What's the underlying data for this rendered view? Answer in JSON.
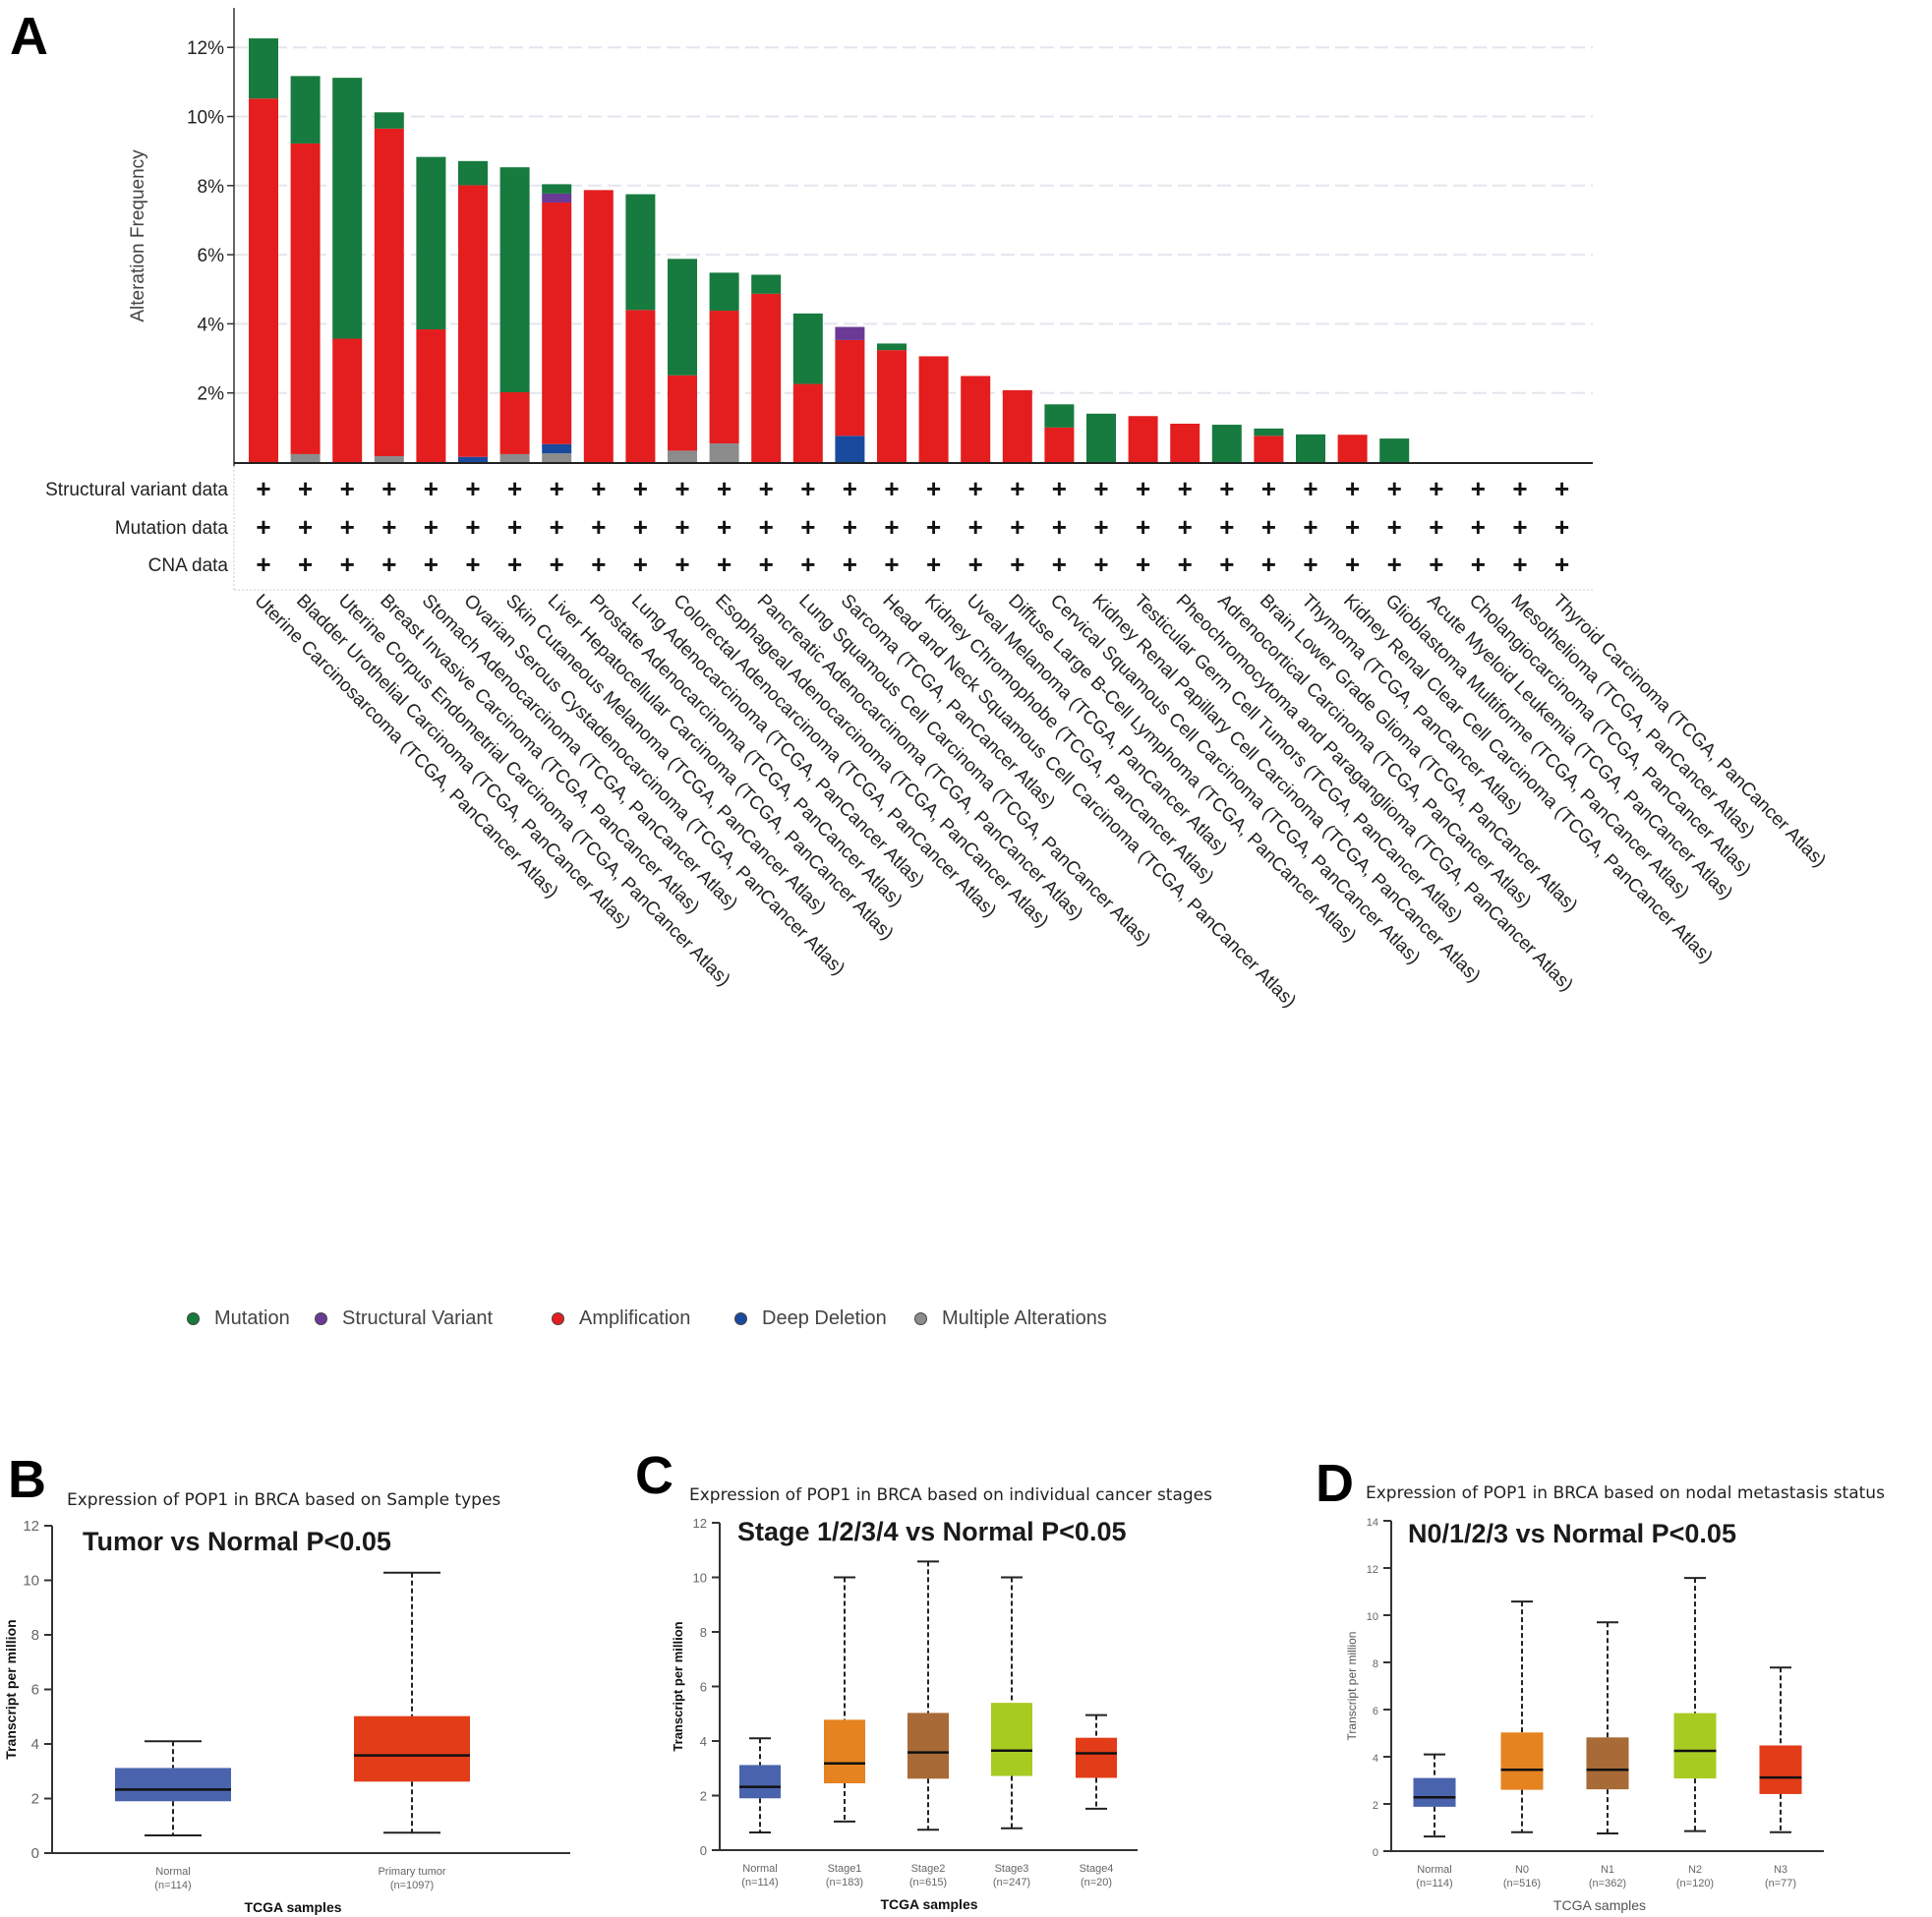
{
  "figure": {
    "panel_labels": [
      "A",
      "B",
      "C",
      "D"
    ]
  },
  "chart_data": [
    {
      "id": "A",
      "type": "bar",
      "stacked": true,
      "title": "",
      "xlabel": "",
      "ylabel": "Alteration Frequency",
      "ylim": [
        0,
        13
      ],
      "yticks": [
        2,
        4,
        6,
        8,
        10,
        12
      ],
      "ytick_labels": [
        "2%",
        "4%",
        "6%",
        "8%",
        "10%",
        "12%"
      ],
      "grid": true,
      "legend_position": "bottom",
      "categories": [
        "Uterine Carcinosarcoma (TCGA, PanCancer Atlas)",
        "Bladder Urothelial Carcinoma (TCGA, PanCancer Atlas)",
        "Uterine Corpus Endometrial Carcinoma (TCGA, PanCancer Atlas)",
        "Breast Invasive Carcinoma (TCGA, PanCancer Atlas)",
        "Stomach Adenocarcinoma (TCGA, PanCancer Atlas)",
        "Ovarian Serous Cystadenocarcinoma (TCGA, PanCancer Atlas)",
        "Skin Cutaneous Melanoma (TCGA, PanCancer Atlas)",
        "Liver Hepatocellular Carcinoma (TCGA, PanCancer Atlas)",
        "Prostate Adenocarcinoma (TCGA, PanCancer Atlas)",
        "Lung Adenocarcinoma (TCGA, PanCancer Atlas)",
        "Colorectal Adenocarcinoma (TCGA, PanCancer Atlas)",
        "Esophageal Adenocarcinoma (TCGA, PanCancer Atlas)",
        "Pancreatic Adenocarcinoma (TCGA, PanCancer Atlas)",
        "Lung Squamous Cell Carcinoma (TCGA, PanCancer Atlas)",
        "Sarcoma (TCGA, PanCancer Atlas)",
        "Head and Neck Squamous Cell Carcinoma (TCGA, PanCancer Atlas)",
        "Kidney Chromophobe (TCGA, PanCancer Atlas)",
        "Uveal Melanoma (TCGA, PanCancer Atlas)",
        "Diffuse Large B-Cell Lymphoma (TCGA, PanCancer Atlas)",
        "Cervical Squamous Cell Carcinoma (TCGA, PanCancer Atlas)",
        "Kidney Renal Papillary Cell Carcinoma (TCGA, PanCancer Atlas)",
        "Testicular Germ Cell Tumors (TCGA, PanCancer Atlas)",
        "Pheochromocytoma and Paraganglioma (TCGA, PanCancer Atlas)",
        "Adrenocortical Carcinoma (TCGA, PanCancer Atlas)",
        "Brain Lower Grade Glioma (TCGA, PanCancer Atlas)",
        "Thymoma (TCGA, PanCancer Atlas)",
        "Kidney Renal Clear Cell Carcinoma (TCGA, PanCancer Atlas)",
        "Glioblastoma Multiforme (TCGA, PanCancer Atlas)",
        "Acute Myeloid Leukemia (TCGA, PanCancer Atlas)",
        "Cholangiocarcinoma (TCGA, PanCancer Atlas)",
        "Mesothelioma (TCGA, PanCancer Atlas)",
        "Thyroid Carcinoma (TCGA, PanCancer Atlas)"
      ],
      "series_order_bottom_to_top": [
        "Multiple Alterations",
        "Deep Deletion",
        "Amplification",
        "Structural Variant",
        "Mutation"
      ],
      "series": [
        {
          "name": "Multiple Alterations",
          "color": "#8c8c8c",
          "values": [
            0,
            0.23,
            0,
            0.17,
            0,
            0,
            0.23,
            0.25,
            0,
            0,
            0.33,
            0.54,
            0,
            0,
            0,
            0,
            0,
            0,
            0,
            0,
            0,
            0,
            0,
            0,
            0,
            0,
            0,
            0,
            0,
            0,
            0,
            0
          ]
        },
        {
          "name": "Deep Deletion",
          "color": "#1a4a9e",
          "values": [
            0,
            0,
            0,
            0,
            0,
            0.15,
            0,
            0.27,
            0,
            0,
            0,
            0,
            0,
            0,
            0.76,
            0,
            0,
            0,
            0,
            0,
            0,
            0,
            0,
            0,
            0,
            0,
            0,
            0,
            0,
            0,
            0,
            0
          ]
        },
        {
          "name": "Amplification",
          "color": "#e41e1e",
          "values": [
            10.52,
            8.99,
            3.57,
            9.48,
            3.84,
            7.86,
            1.79,
            6.99,
            7.87,
            4.4,
            2.18,
            3.84,
            4.87,
            2.26,
            2.77,
            3.24,
            3.06,
            2.49,
            2.08,
            1.0,
            0,
            1.33,
            1.11,
            0,
            0.76,
            0,
            0.79,
            0,
            0,
            0,
            0,
            0
          ]
        },
        {
          "name": "Structural Variant",
          "color": "#6b3a96",
          "values": [
            0,
            0,
            0,
            0,
            0,
            0,
            0,
            0.26,
            0,
            0,
            0,
            0,
            0,
            0,
            0.38,
            0,
            0,
            0,
            0,
            0,
            0,
            0,
            0,
            0,
            0,
            0,
            0,
            0,
            0,
            0,
            0,
            0
          ]
        },
        {
          "name": "Mutation",
          "color": "#177a3e",
          "values": [
            1.74,
            1.95,
            7.55,
            0.47,
            4.99,
            0.7,
            6.51,
            0.27,
            0,
            3.35,
            3.37,
            1.1,
            0.55,
            2.04,
            0,
            0.19,
            0,
            0,
            0,
            0.67,
            1.4,
            0,
            0,
            1.08,
            0.21,
            0.8,
            0,
            0.68,
            0,
            0,
            0,
            0
          ]
        }
      ],
      "totals": [
        12.26,
        11.17,
        11.12,
        10.12,
        8.83,
        8.71,
        8.53,
        8.04,
        7.87,
        7.75,
        5.88,
        5.48,
        5.42,
        4.3,
        3.91,
        3.43,
        3.06,
        2.49,
        2.08,
        1.67,
        1.4,
        1.33,
        1.11,
        1.08,
        0.97,
        0.8,
        0.79,
        0.68,
        0,
        0,
        0,
        0
      ],
      "data_availability_rows": [
        {
          "label": "Structural variant data",
          "marker": "+",
          "available": "all"
        },
        {
          "label": "Mutation data",
          "marker": "+",
          "available": "all"
        },
        {
          "label": "CNA data",
          "marker": "+",
          "available": "all"
        }
      ],
      "legend": [
        {
          "label": "Mutation",
          "color": "#177a3e"
        },
        {
          "label": "Structural Variant",
          "color": "#6b3a96"
        },
        {
          "label": "Amplification",
          "color": "#e41e1e"
        },
        {
          "label": "Deep Deletion",
          "color": "#1a4a9e"
        },
        {
          "label": "Multiple Alterations",
          "color": "#8c8c8c"
        }
      ]
    },
    {
      "id": "B",
      "type": "box",
      "title": "Expression of POP1 in BRCA based on Sample types",
      "annotation": "Tumor vs Normal P<0.05",
      "xlabel": "TCGA samples",
      "ylabel": "Transcript per million",
      "ylim": [
        0,
        12
      ],
      "yticks": [
        0,
        2,
        4,
        6,
        8,
        10,
        12
      ],
      "groups": [
        {
          "label": "Normal",
          "n": "(n=114)",
          "color": "#4a63ad",
          "min": 0.65,
          "q1": 1.9,
          "median": 2.33,
          "q3": 3.12,
          "max": 4.1
        },
        {
          "label": "Primary tumor",
          "n": "(n=1097)",
          "color": "#e23c18",
          "min": 0.75,
          "q1": 2.62,
          "median": 3.58,
          "q3": 5.02,
          "max": 10.28
        }
      ]
    },
    {
      "id": "C",
      "type": "box",
      "title": "Expression of POP1 in BRCA based on individual cancer stages",
      "annotation": "Stage 1/2/3/4 vs Normal P<0.05",
      "xlabel": "TCGA samples",
      "ylabel": "Transcript per million",
      "ylim": [
        0,
        12
      ],
      "yticks": [
        0,
        2,
        4,
        6,
        8,
        10,
        12
      ],
      "groups": [
        {
          "label": "Normal",
          "n": "(n=114)",
          "color": "#4a63ad",
          "min": 0.65,
          "q1": 1.9,
          "median": 2.32,
          "q3": 3.12,
          "max": 4.1
        },
        {
          "label": "Stage1",
          "n": "(n=183)",
          "color": "#e48320",
          "min": 1.05,
          "q1": 2.45,
          "median": 3.18,
          "q3": 4.78,
          "max": 10.0
        },
        {
          "label": "Stage2",
          "n": "(n=615)",
          "color": "#a86a36",
          "min": 0.75,
          "q1": 2.62,
          "median": 3.58,
          "q3": 5.03,
          "max": 10.58
        },
        {
          "label": "Stage3",
          "n": "(n=247)",
          "color": "#a8cb22",
          "min": 0.8,
          "q1": 2.72,
          "median": 3.65,
          "q3": 5.4,
          "max": 10.0
        },
        {
          "label": "Stage4",
          "n": "(n=20)",
          "color": "#e23c18",
          "min": 1.52,
          "q1": 2.65,
          "median": 3.55,
          "q3": 4.12,
          "max": 4.95
        }
      ]
    },
    {
      "id": "D",
      "type": "box",
      "title": "Expression of POP1 in BRCA based on nodal metastasis status",
      "annotation": "N0/1/2/3 vs Normal P<0.05",
      "xlabel": "TCGA samples",
      "ylabel": "Transcript per million",
      "ylim": [
        0,
        14
      ],
      "yticks": [
        0,
        2,
        4,
        6,
        8,
        10,
        12,
        14
      ],
      "groups": [
        {
          "label": "Normal",
          "n": "(n=114)",
          "color": "#4a63ad",
          "min": 0.62,
          "q1": 1.88,
          "median": 2.28,
          "q3": 3.1,
          "max": 4.1
        },
        {
          "label": "N0",
          "n": "(n=516)",
          "color": "#e48320",
          "min": 0.8,
          "q1": 2.6,
          "median": 3.45,
          "q3": 5.03,
          "max": 10.58
        },
        {
          "label": "N1",
          "n": "(n=362)",
          "color": "#a86a36",
          "min": 0.75,
          "q1": 2.62,
          "median": 3.45,
          "q3": 4.82,
          "max": 9.7
        },
        {
          "label": "N2",
          "n": "(n=120)",
          "color": "#a8cb22",
          "min": 0.85,
          "q1": 3.08,
          "median": 4.25,
          "q3": 5.85,
          "max": 11.58
        },
        {
          "label": "N3",
          "n": "(n=77)",
          "color": "#e23c18",
          "min": 0.8,
          "q1": 2.42,
          "median": 3.12,
          "q3": 4.48,
          "max": 7.78
        }
      ]
    }
  ]
}
